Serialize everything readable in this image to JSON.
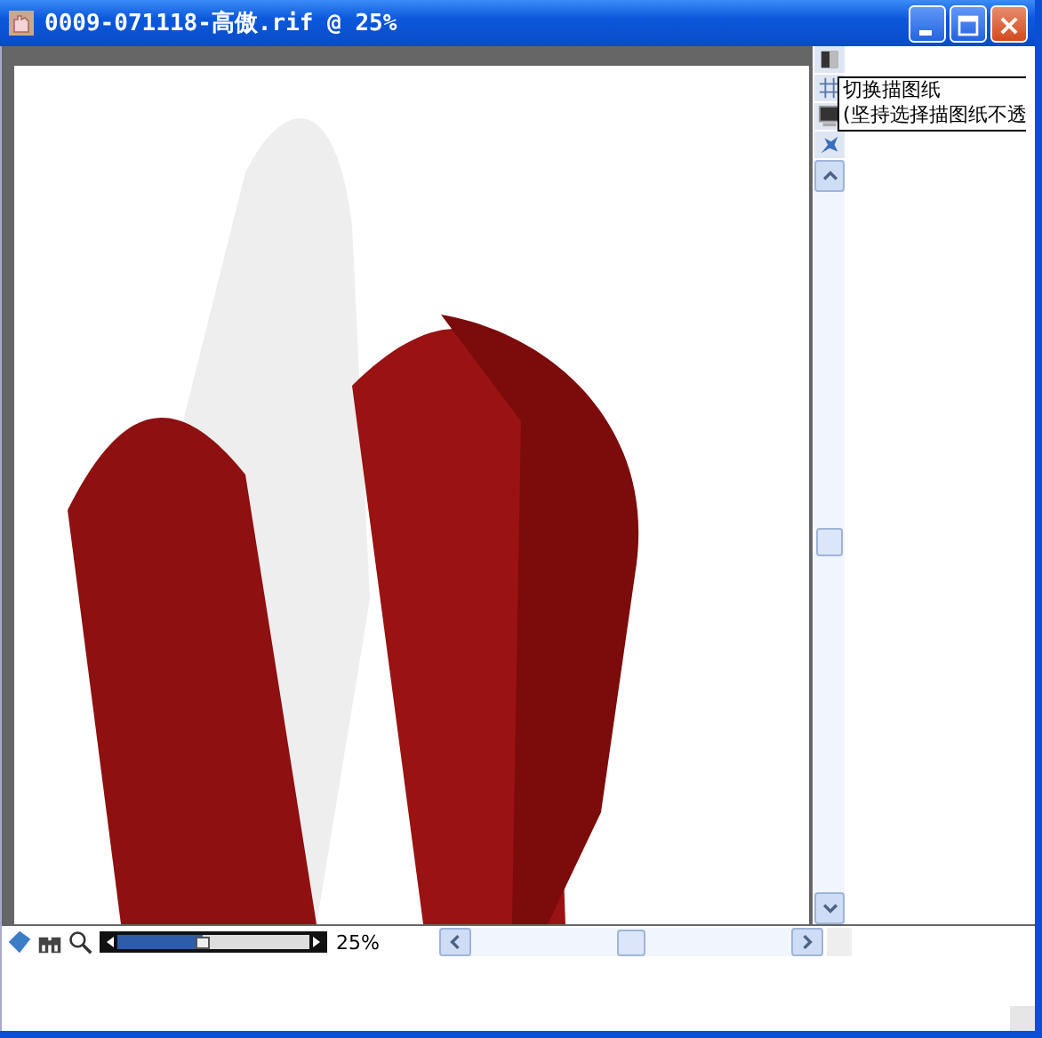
{
  "window": {
    "title": "0009-071118-高傲.rif @ 25%"
  },
  "tooltip": {
    "lines": [
      "切换描图纸",
      "(坚持选择描图纸不透"
    ]
  },
  "zoom": {
    "level": 0.44,
    "reading": "25%"
  }
}
